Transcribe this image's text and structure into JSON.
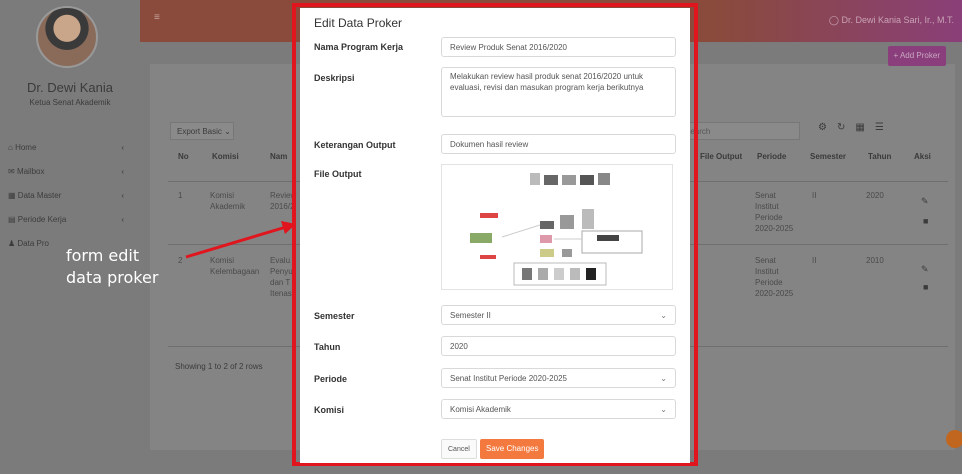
{
  "sidebar": {
    "user_name": "Dr. Dewi Kania",
    "user_role": "Ketua Senat Akademik",
    "items": [
      {
        "label": "Home",
        "icon": "home-icon"
      },
      {
        "label": "Mailbox",
        "icon": "envelope-icon"
      },
      {
        "label": "Data Master",
        "icon": "database-icon"
      },
      {
        "label": "Periode Kerja",
        "icon": "bar-chart-icon"
      },
      {
        "label": "Data Pro",
        "icon": "user-icon"
      }
    ]
  },
  "topbar": {
    "user": "Dr. Dewi Kania Sari, Ir., M.T."
  },
  "main": {
    "add_button": "+ Add Proker",
    "export_label": "Export Basic",
    "search_placeholder": "Search",
    "columns": [
      "No",
      "Komisi",
      "Nam",
      "File Output",
      "Periode",
      "Semester",
      "Tahun",
      "Aksi"
    ],
    "rows": [
      {
        "no": "1",
        "komisi": "Komisi Akademik",
        "nama": "Review 2016/2",
        "periode": "Senat Institut Periode 2020-2025",
        "semester": "II",
        "tahun": "2020"
      },
      {
        "no": "2",
        "komisi": "Komisi Kelembagaan",
        "nama": "Evalu Penyu dan T Itenas",
        "periode": "Senat Institut Periode 2020-2025",
        "semester": "II",
        "tahun": "2010"
      }
    ],
    "showing": "Showing 1 to 2 of 2 rows"
  },
  "annotation": {
    "line1": "form edit",
    "line2": "data proker",
    "arrow_color": "#e0151e"
  },
  "modal": {
    "title": "Edit Data Proker",
    "nama_label": "Nama Program Kerja",
    "nama_value": "Review Produk Senat 2016/2020",
    "deskripsi_label": "Deskripsi",
    "deskripsi_value": "Melakukan review hasil produk senat 2016/2020 untuk evaluasi, revisi dan masukan program kerja berikutnya",
    "keterangan_label": "Keterangan Output",
    "keterangan_value": "Dokumen hasil review",
    "file_label": "File Output",
    "semester_label": "Semester",
    "semester_value": "Semester II",
    "tahun_label": "Tahun",
    "tahun_value": "2020",
    "periode_label": "Periode",
    "periode_value": "Senat Institut Periode 2020-2025",
    "komisi_label": "Komisi",
    "komisi_value": "Komisi Akademik",
    "cancel_label": "Cancel",
    "save_label": "Save Changes",
    "highlight_color": "#e0151e",
    "save_color": "#f4793e"
  }
}
